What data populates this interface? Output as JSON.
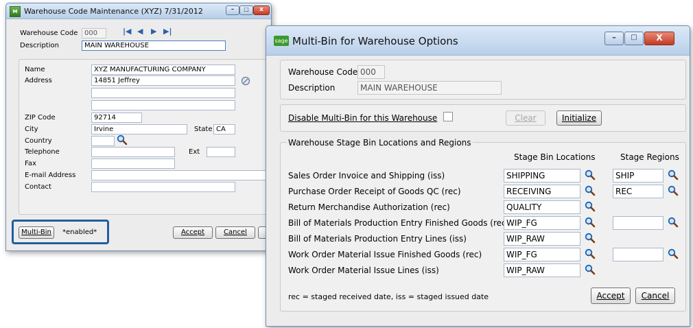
{
  "win1": {
    "title": "Warehouse Code Maintenance (XYZ) 7/31/2012",
    "icon": "app-green-icon",
    "header": {
      "warehouse_code_label": "Warehouse Code",
      "warehouse_code_value": "000",
      "description_label": "Description",
      "description_value": "MAIN WAREHOUSE"
    },
    "address": {
      "name_label": "Name",
      "name_value": "XYZ MANUFACTURING COMPANY",
      "address_label": "Address",
      "address_value": "14851 Jeffrey",
      "zip_label": "ZIP Code",
      "zip_value": "92714",
      "city_label": "City",
      "city_value": "Irvine",
      "state_label": "State",
      "state_value": "CA",
      "country_label": "Country",
      "telephone_label": "Telephone",
      "ext_label": "Ext",
      "fax_label": "Fax",
      "email_label": "E-mail Address",
      "contact_label": "Contact"
    },
    "footer": {
      "multibin_label": "Multi-Bin",
      "enabled_text": "*enabled*",
      "accept_label": "Accept",
      "cancel_label": "Cancel"
    },
    "highlight_color": "#1f5fa0"
  },
  "win2": {
    "title": "Multi-Bin for Warehouse Options",
    "logo": "sage",
    "warehouse_code_label": "Warehouse Code",
    "warehouse_code_value": "000",
    "description_label": "Description",
    "description_value": "MAIN WAREHOUSE",
    "disable_label": "Disable Multi-Bin for this Warehouse",
    "clear_label": "Clear",
    "initialize_label": "Initialize",
    "section_title": "Warehouse Stage Bin Locations and Regions",
    "col_locations": "Stage Bin Locations",
    "col_regions": "Stage Regions",
    "rows": [
      {
        "label": "Sales Order Invoice and Shipping (iss)",
        "location": "SHIPPING",
        "region": "SHIP"
      },
      {
        "label": "Purchase Order Receipt of Goods QC (rec)",
        "location": "RECEIVING",
        "region": "REC"
      },
      {
        "label": "Return Merchandise Authorization (rec)",
        "location": "QUALITY",
        "region": null
      },
      {
        "label": "Bill of Materials Production Entry Finished Goods (rec)",
        "location": "WIP_FG",
        "region": ""
      },
      {
        "label": "Bill of Materials Production Entry Lines (iss)",
        "location": "WIP_RAW",
        "region": null
      },
      {
        "label": "Work Order Material Issue Finished Goods (rec)",
        "location": "WIP_FG",
        "region": ""
      },
      {
        "label": "Work Order Material Issue Lines (iss)",
        "location": "WIP_RAW",
        "region": null
      }
    ],
    "legend": "rec = staged received date, iss = staged issued date",
    "accept_label": "Accept",
    "cancel_label": "Cancel"
  }
}
